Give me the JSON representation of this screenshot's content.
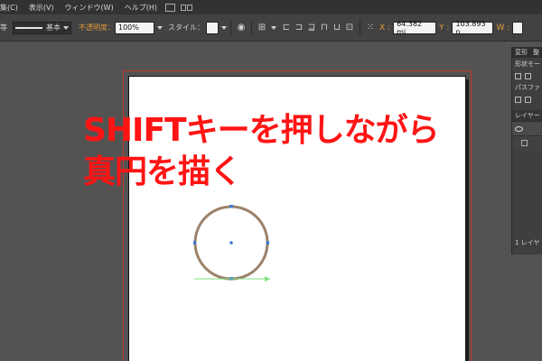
{
  "menu": {
    "items": [
      "集(C)",
      "表示(V)",
      "ウィンドウ(W)",
      "ヘルプ(H)"
    ]
  },
  "control_bar": {
    "stroke_profile_label": "等",
    "stroke_style_label": "基本",
    "opacity_label": "不透明度：",
    "opacity_value": "100%",
    "style_label": "スタイル：",
    "x_label": "X :",
    "x_value": "64.382 mi",
    "y_label": "Y :",
    "y_value": "103.893 n",
    "w_label": "W :"
  },
  "caption": {
    "line1": "SHIFTキーを押しながら",
    "line2": "真円を描く"
  },
  "panel": {
    "tab1": "変形",
    "tab2": "整",
    "shape_mode_label": "形状モー",
    "pathfinder_label": "パスファ",
    "layers_tab": "レイヤー",
    "layers_footer": "1 レイヤ"
  },
  "colors": {
    "circle_stroke": "#9c826b",
    "guide": "#7de07d",
    "selection": "#3a7bd5",
    "caption": "#ff1414",
    "artboard_border": "#c0392b"
  }
}
